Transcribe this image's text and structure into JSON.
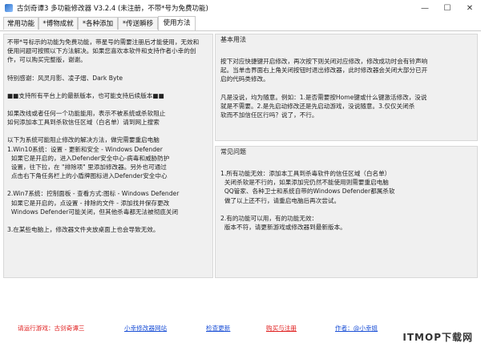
{
  "window": {
    "title": "古剑奇谭3 多功能修改器  V3.2.4  (未注册，不带*号为免费功能)",
    "minimize": "—",
    "maximize": "☐",
    "close": "✕"
  },
  "tabs": [
    {
      "label": "常用功能"
    },
    {
      "label": "*博物成就"
    },
    {
      "label": "*各种添加"
    },
    {
      "label": "*传送瞬移"
    },
    {
      "label": "使用方法",
      "active": true
    }
  ],
  "left_panel": {
    "lines": [
      "不带*号标示的功能为免费功能，带星号的需要注册后才能使用，无效和",
      "使用问题可按照以下方法解决。如果您喜欢本软件和支持作者小幸的创",
      "作，可以购买完整版，谢谢。",
      "",
      "特别感谢：风灵月影、凌子熠、Dark Byte",
      "",
      "■■支持所有平台上的最新版本，也可能支持后续版本■■",
      "",
      "如果改线或者任何一个功能能用，表示不被系统或杀软阻止",
      "如何添加本工具到杀软信任区域（白名单）请到网上搜索",
      "",
      "以下为系统可能阻止修改的解决方法，做完需要重启电脑",
      "1.Win10系统：设置 - 更新和安全 - Windows Defender",
      "  如果它是开启的，进入Defender安全中心-病毒和威胁防护",
      "  设置，往下拉，在 \"排除项\" 里添加修改器。另外也可通过",
      "  点击右下角任务栏上的小盾牌图标进入Defender安全中心",
      "",
      "2.Win7系统：控制面板 - 查看方式:图标 - Windows Defender",
      "  如果它是开启的，点设置 - 排除的文件 - 添加找并保存更改",
      "  Windows Defender可能关闭，但其他杀毒都无法被彻底关闭",
      "",
      "3.在某些电脑上，修改器文件夹放桌面上也会导致无效。"
    ]
  },
  "basic_usage": {
    "title": "基本用法",
    "lines": [
      "按下对应快捷键开启修改，再次按下则关闭对应修改，修改成功时会有铃声响",
      "起。当单击界面右上角关闭按钮时退出修改器，此时修改器会关闭大部分已开",
      "启的代码类修改。",
      "",
      "凡是没说，均为随意。例如：1.是否需要按Home键或什么键激活修改，没说",
      "就是不需要。2.是先启动修改还是先启动游戏，没说随意。3.仅仅关闭杀",
      "软而不加信任区行吗？说了，不行。"
    ]
  },
  "faq": {
    "title": "常见问题",
    "lines": [
      "1.所有功能无效：添加本工具到杀毒软件的信任区域（白名单）",
      "  关闭杀软是不行的，如果添加完仍然不能使用则需要重启电脑",
      "  QQ管家、各种卫士和系统自带的Windows Defender都属杀软",
      "  做了以上还不行，请重启电脑后再次尝试。",
      "",
      "2.有的功能可以用，有的功能无效：",
      "  版本不符，请更新游戏或修改器到最新版本。"
    ]
  },
  "footer": {
    "run_game": "请运行游戏：古剑奇谭三",
    "website": "小幸修改器网站",
    "update": "检查更新",
    "register": "购买与注册",
    "author": "作者：@小幸姐"
  },
  "watermark": "ITMOP下载网"
}
